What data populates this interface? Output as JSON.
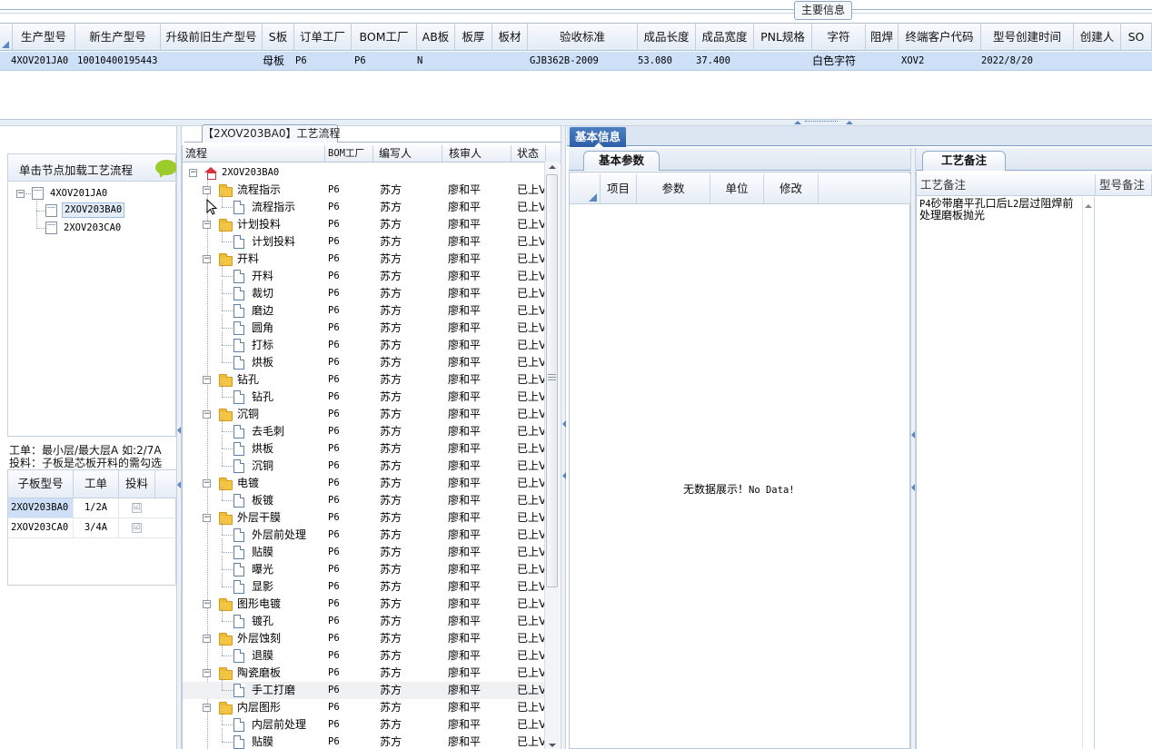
{
  "top": {
    "group_title": "主要信息",
    "columns": [
      "生产型号",
      "新生产型号",
      "升级前旧生产型号",
      "S板",
      "订单工厂",
      "BOM工厂",
      "AB板",
      "板厚",
      "板材",
      "验收标准",
      "成品长度",
      "成品宽度",
      "PNL规格",
      "字符",
      "阻焊",
      "终端客户代码",
      "型号创建时间",
      "创建人",
      "SO"
    ],
    "row": {
      "prod_model": "4XOV201JA0",
      "new_model": "10010400195443",
      "board_type": "母板",
      "order_factory": "P6",
      "bom_factory": "P6",
      "ab": "N",
      "standard": "GJB362B-2009",
      "length": "53.080",
      "width": "37.400",
      "char": "白色字符",
      "cust_code": "XOV2",
      "create_time": "2022/8/20"
    }
  },
  "left": {
    "header": "单击节点加载工艺流程",
    "tree": {
      "root": "4XOV201JA0",
      "children": [
        "2XOV203BA0",
        "2XOV203CA0"
      ]
    },
    "note1": "工单：最小层/最大层A 如:2/7A",
    "note2": "投料：子板是芯板开料的需勾选",
    "sub_grid": {
      "columns": [
        "子板型号",
        "工单",
        "投料"
      ],
      "rows": [
        {
          "model": "2XOV203BA0",
          "order": "1/2A",
          "feed": "☑"
        },
        {
          "model": "2XOV203CA0",
          "order": "3/4A",
          "feed": "☑"
        }
      ]
    }
  },
  "process": {
    "title_model": "2XOV203BA0",
    "title": "【2XOV203BA0】工艺流程",
    "columns": [
      "流程",
      "BOM工厂",
      "编写人",
      "核审人",
      "状态"
    ],
    "root": "2XOV203BA0",
    "factory": "P6",
    "writer": "苏方",
    "reviewer": "廖和平",
    "status": "已上V",
    "groups": [
      {
        "name": "流程指示",
        "steps": [
          "流程指示"
        ]
      },
      {
        "name": "计划投料",
        "steps": [
          "计划投料"
        ]
      },
      {
        "name": "开料",
        "steps": [
          "开料",
          "裁切",
          "磨边",
          "圆角",
          "打标",
          "烘板"
        ]
      },
      {
        "name": "钻孔",
        "steps": [
          "钻孔"
        ]
      },
      {
        "name": "沉铜",
        "steps": [
          "去毛刺",
          "烘板",
          "沉铜"
        ]
      },
      {
        "name": "电镀",
        "steps": [
          "板镀"
        ]
      },
      {
        "name": "外层干膜",
        "steps": [
          "外层前处理",
          "贴膜",
          "曝光",
          "显影"
        ]
      },
      {
        "name": "图形电镀",
        "steps": [
          "镀孔"
        ]
      },
      {
        "name": "外层蚀刻",
        "steps": [
          "退膜"
        ]
      },
      {
        "name": "陶瓷磨板",
        "steps": [
          "手工打磨"
        ]
      },
      {
        "name": "内层图形",
        "steps": [
          "内层前处理",
          "贴膜"
        ]
      }
    ]
  },
  "basic": {
    "tab": "基本信息",
    "subtab": "基本参数",
    "columns": [
      "项目",
      "参数",
      "单位",
      "修改"
    ],
    "nodata_cn": "无数据展示！",
    "nodata_en": "No Data!"
  },
  "remarks": {
    "subtab": "工艺备注",
    "col1": "工艺备注",
    "col2": "型号备注",
    "text_line1_a": "P4",
    "text_line1_b": "砂带磨平孔口后",
    "text_line1_c": "L2",
    "text_line1_d": "层过阻焊前",
    "text_line2": "处理磨板抛光"
  },
  "colors": {
    "selected_row": "#cde0f7",
    "tab_blue": "#2d5fa6",
    "folder": "#f4c545",
    "bubble": "#9ccb2c"
  }
}
